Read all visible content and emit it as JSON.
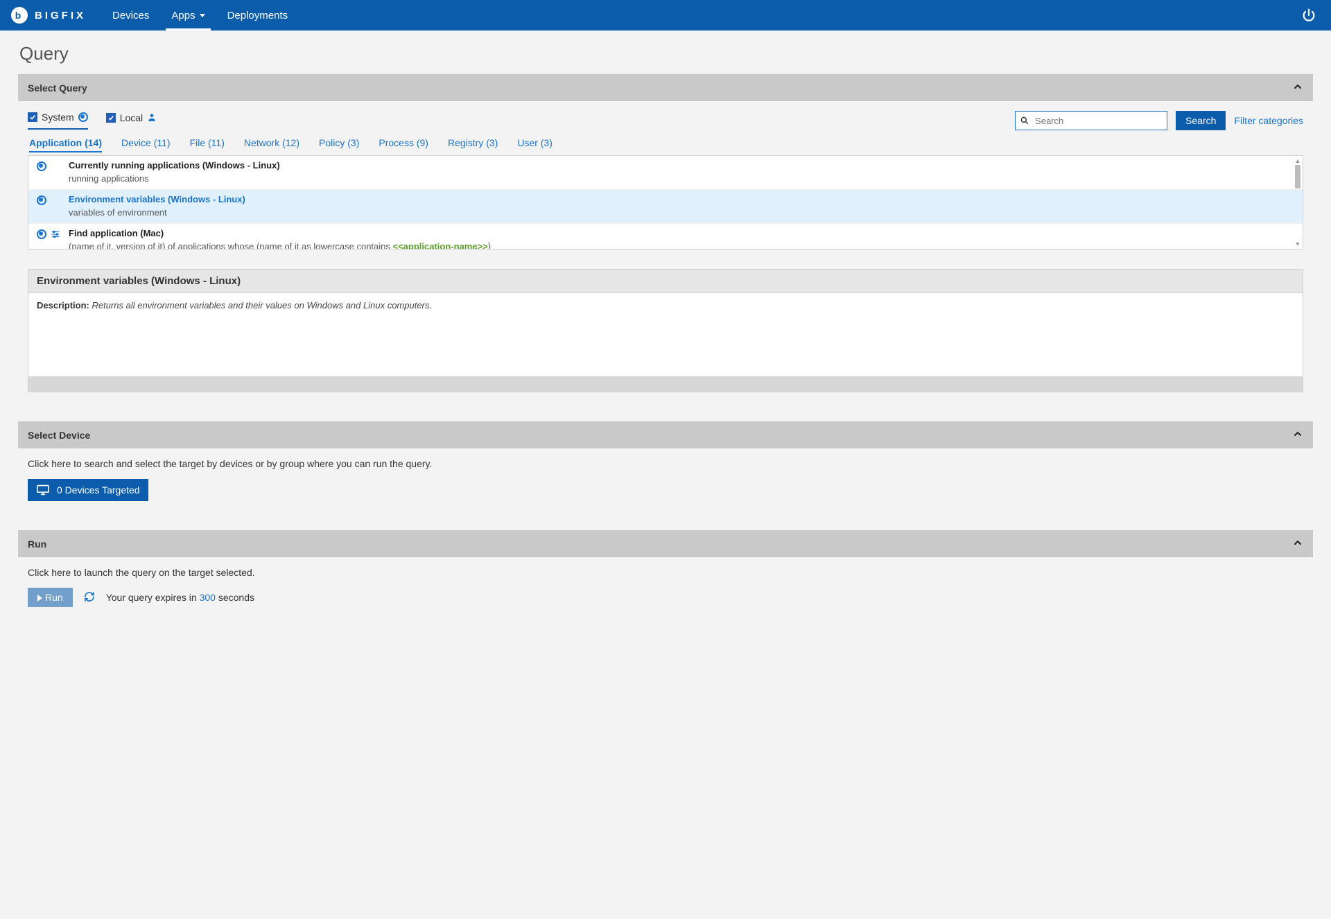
{
  "brand": "BIGFIX",
  "nav": [
    {
      "label": "Devices",
      "active": false
    },
    {
      "label": "Apps",
      "active": true,
      "caret": true
    },
    {
      "label": "Deployments",
      "active": false
    }
  ],
  "page_title": "Query",
  "select_query": {
    "header": "Select Query",
    "scope": {
      "system": "System",
      "local": "Local"
    },
    "search_placeholder": "Search",
    "search_button": "Search",
    "filter_link": "Filter categories",
    "categories": [
      {
        "label": "Application (14)",
        "active": true
      },
      {
        "label": "Device (11)"
      },
      {
        "label": "File (11)"
      },
      {
        "label": "Network (12)"
      },
      {
        "label": "Policy (3)"
      },
      {
        "label": "Process (9)"
      },
      {
        "label": "Registry (3)"
      },
      {
        "label": "User (3)"
      }
    ],
    "rows": [
      {
        "title": "Currently running applications (Windows - Linux)",
        "subtitle": "running applications",
        "selected": false,
        "has_sliders": false
      },
      {
        "title": "Environment variables (Windows - Linux)",
        "subtitle": "variables of environment",
        "selected": true,
        "has_sliders": false
      },
      {
        "title": "Find application (Mac)",
        "prefix": "(name of it, version of it) of applications whose (name of it as lowercase contains ",
        "param": "<<application-name>>",
        "suffix": ")",
        "selected": false,
        "has_sliders": true
      }
    ],
    "detail": {
      "title": "Environment variables (Windows - Linux)",
      "desc_label": "Description:",
      "desc_value": "Returns all environment variables and their values on Windows and Linux computers."
    }
  },
  "select_device": {
    "header": "Select Device",
    "hint": "Click here to search and select the target by devices or by group where you can run the query.",
    "button": "0 Devices Targeted"
  },
  "run": {
    "header": "Run",
    "hint": "Click here to launch the query on the target selected.",
    "button": "Run",
    "expires_prefix": "Your query expires in ",
    "expires_seconds": "300",
    "expires_suffix": " seconds"
  }
}
